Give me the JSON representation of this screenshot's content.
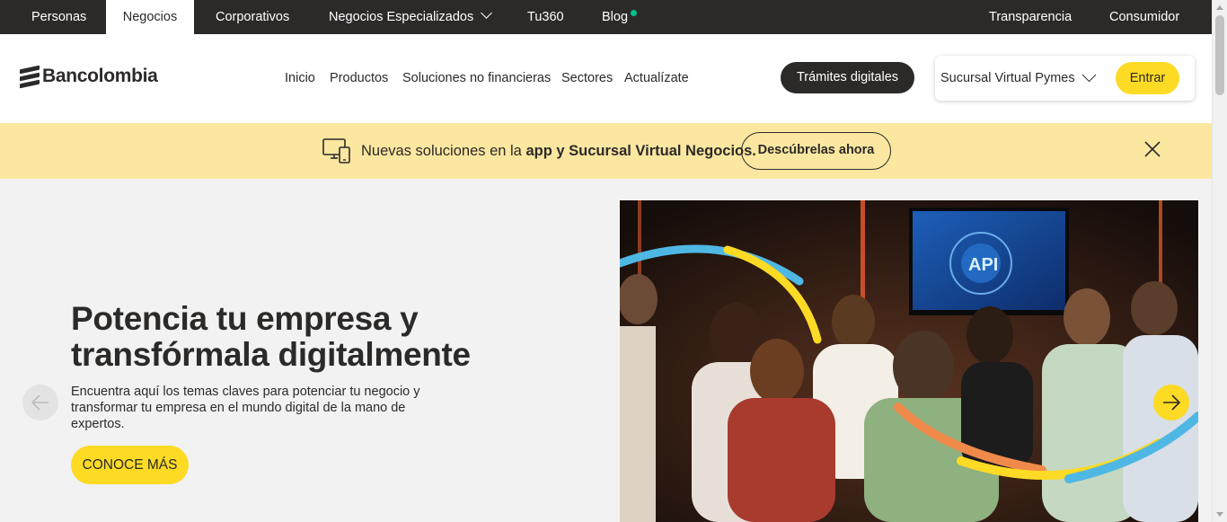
{
  "topnav": {
    "personas": "Personas",
    "negocios": "Negocios",
    "corporativos": "Corporativos",
    "especializados": "Negocios Especializados",
    "tu360": "Tu360",
    "blog": "Blog",
    "transparencia": "Transparencia",
    "consumidor": "Consumidor"
  },
  "header": {
    "logo_text": "Bancolombia",
    "nav": {
      "inicio": "Inicio",
      "productos": "Productos",
      "soluciones": "Soluciones no financieras",
      "sectores": "Sectores",
      "actualizate": "Actualízate"
    },
    "tramites_label": "Trámites digitales",
    "sucursal_label": "Sucursal Virtual Pymes",
    "entrar_label": "Entrar"
  },
  "banner": {
    "text_prefix": "Nuevas soluciones en la ",
    "text_bold": "app y Sucursal Virtual Negocios.",
    "button_label": "Descúbrelas ahora"
  },
  "hero": {
    "title": "Potencia tu empresa y transfórmala digitalmente",
    "description": "Encuentra aquí los temas claves para potenciar tu negocio y transformar tu empresa en el mundo digital de la mano de expertos.",
    "cta_label": "CONOCE MÁS",
    "screen_text": "API"
  },
  "colors": {
    "brand_yellow": "#fdda24",
    "dark": "#2c2a29",
    "banner_bg": "#fbe7a0",
    "blog_dot": "#00c389"
  }
}
